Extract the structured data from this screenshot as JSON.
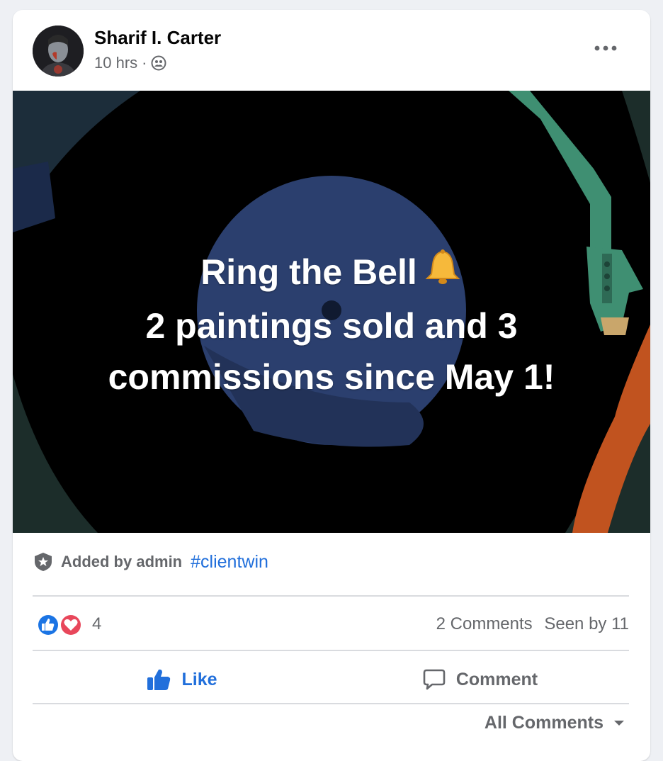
{
  "post": {
    "author": "Sharif I. Carter",
    "time": "10 hrs",
    "separator": "·",
    "privacy_icon": "group-icon",
    "more_icon": "more-horizontal-icon",
    "image_text": {
      "line1": "Ring the Bell",
      "emoji": "bell-emoji",
      "line2": "2 paintings sold and 3",
      "line3": "commissions since May 1!"
    },
    "admin_label": "Added by admin",
    "admin_icon": "shield-star-icon",
    "hashtag": "#clientwin",
    "reactions": {
      "icons": [
        "like-reaction-icon",
        "love-reaction-icon"
      ],
      "count": "4"
    },
    "comments_count": "2 Comments",
    "seen_by": "Seen by 11",
    "actions": {
      "like": "Like",
      "comment": "Comment"
    },
    "all_comments": "All Comments"
  },
  "colors": {
    "accent": "#216fdb",
    "muted": "#65676b",
    "love": "#e8475b",
    "image_circle": "#2b3f6e",
    "arm_green": "#3f8f72",
    "orange": "#c1531f"
  }
}
